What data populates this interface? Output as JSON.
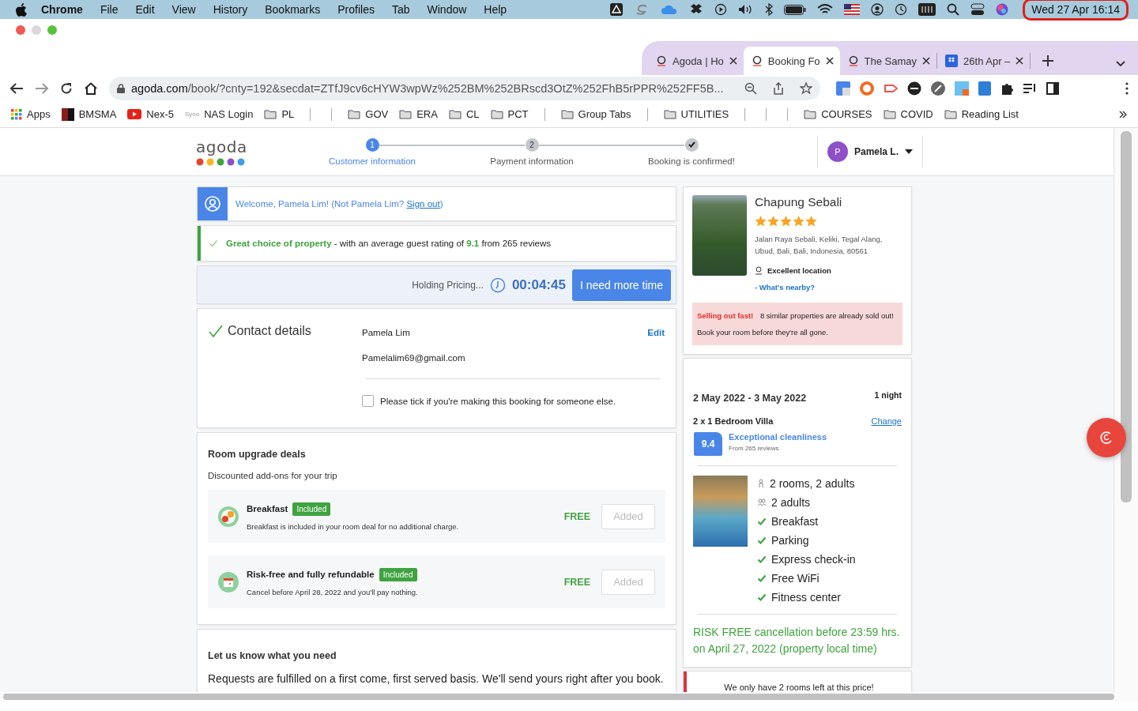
{
  "menubar": {
    "app": "Chrome",
    "menus": [
      "File",
      "Edit",
      "View",
      "History",
      "Bookmarks",
      "Profiles",
      "Tab",
      "Window",
      "Help"
    ],
    "clock": "Wed 27 Apr  16:14"
  },
  "tabs": [
    {
      "title": "Agoda | Ho",
      "kind": "agoda",
      "selected": false
    },
    {
      "title": "Booking Fo",
      "kind": "agoda",
      "selected": true
    },
    {
      "title": "The Samay",
      "kind": "agoda",
      "selected": false
    },
    {
      "title": "26th Apr –",
      "kind": "dropbox",
      "selected": false
    }
  ],
  "address": {
    "host": "agoda.com",
    "path": "/book/?cnty=192&secdat=ZTfJ9cv6cHYW3wpWz%252BM%252BRscd3OtZ%252FhB5rPPR%252FF5B..."
  },
  "bookmarks": [
    {
      "kind": "apps",
      "label": "Apps"
    },
    {
      "kind": "bmsma",
      "label": "BMSMA"
    },
    {
      "kind": "youtube",
      "label": "Nex-5"
    },
    {
      "kind": "syno",
      "badge": "Syno",
      "label": "NAS Login"
    },
    {
      "kind": "folder",
      "label": "PL"
    },
    {
      "kind": "separator"
    },
    {
      "kind": "separator"
    },
    {
      "kind": "folder",
      "label": "GOV"
    },
    {
      "kind": "folder",
      "label": "ERA"
    },
    {
      "kind": "folder",
      "label": "CL"
    },
    {
      "kind": "folder",
      "label": "PCT"
    },
    {
      "kind": "separator"
    },
    {
      "kind": "folder",
      "label": "Group Tabs"
    },
    {
      "kind": "separator"
    },
    {
      "kind": "folder",
      "label": "UTILITIES"
    },
    {
      "kind": "separator"
    },
    {
      "kind": "separator"
    },
    {
      "kind": "separator"
    },
    {
      "kind": "folder",
      "label": "COURSES"
    },
    {
      "kind": "folder",
      "label": "COVID"
    },
    {
      "kind": "folder",
      "label": "Reading List"
    }
  ],
  "header": {
    "logo": "agoda",
    "steps": [
      {
        "number": "1",
        "label": "Customer information",
        "active": true,
        "done": false
      },
      {
        "number": "2",
        "label": "Payment information",
        "active": false,
        "done": false
      },
      {
        "label": "Booking is confirmed!",
        "active": false,
        "done": true
      }
    ],
    "user": {
      "initial": "P",
      "name": "Pamela L."
    }
  },
  "welcome": {
    "before": "Welcome, Pamela Lim! (Not Pamela Lim? ",
    "link": "Sign out",
    "after": ")"
  },
  "rating_banner": {
    "highlight": "Great choice of property",
    "text_1": " - with an average guest rating of ",
    "score": "9.1",
    "text_2": " from 265 reviews"
  },
  "timer": {
    "label": "Holding Pricing...",
    "time": "00:04:45",
    "button": "I need more time"
  },
  "contact": {
    "title": "Contact details",
    "name": "Pamela Lim",
    "email": "Pamelalim69@gmail.com",
    "edit": "Edit",
    "checkbox": {
      "label": "Please tick if you're making this booking for someone else.",
      "checked": false
    }
  },
  "upgrades": {
    "title": "Room upgrade deals",
    "subtitle": "Discounted add-ons for your trip",
    "items": [
      {
        "kind": "breakfast",
        "name": "Breakfast",
        "badge": "Included",
        "description": "Breakfast is included in your room deal for no additional charge.",
        "price": "FREE",
        "button": "Added"
      },
      {
        "kind": "refund",
        "name": "Risk-free and fully refundable",
        "badge": "Included",
        "description": "Cancel before April 28, 2022 and you'll pay nothing.",
        "price": "FREE",
        "button": "Added"
      }
    ]
  },
  "requests": {
    "title": "Let us know what you need",
    "text": "Requests are fulfilled on a first come, first served basis. We'll send yours right after you book."
  },
  "hotel": {
    "name": "Chapung Sebali",
    "stars": 5,
    "address": "Jalan Raya Sebali, Keliki, Tegal Alang, Ubud, Bali, Bali, Indonesia, 80561",
    "location": "Excellent location",
    "nearby": "- What's nearby?",
    "alert": {
      "highlight": "Selling out fast!",
      "text": "8 similar properties are already sold out! Book your room before they're all gone."
    }
  },
  "booking": {
    "dates": "2 May 2022 - 3 May 2022",
    "nights": "1 night",
    "room": "2 x 1 Bedroom Villa",
    "change": "Change",
    "score": "9.4",
    "score_label": "Exceptional cleanliness",
    "score_sub": "From 265 reviews",
    "features": [
      {
        "kind": "rooms",
        "text": "2 rooms, 2 adults"
      },
      {
        "kind": "adults",
        "text": "2 adults"
      },
      {
        "kind": "check",
        "text": "Breakfast"
      },
      {
        "kind": "check",
        "text": "Parking"
      },
      {
        "kind": "check",
        "text": "Express check-in"
      },
      {
        "kind": "check",
        "text": "Free WiFi"
      },
      {
        "kind": "check",
        "text": "Fitness center"
      }
    ],
    "cancellation": "RISK FREE cancellation before 23:59 hrs. on April 27, 2022 (property local time)"
  },
  "scarcity": "We only have 2 rooms left at this price!"
}
